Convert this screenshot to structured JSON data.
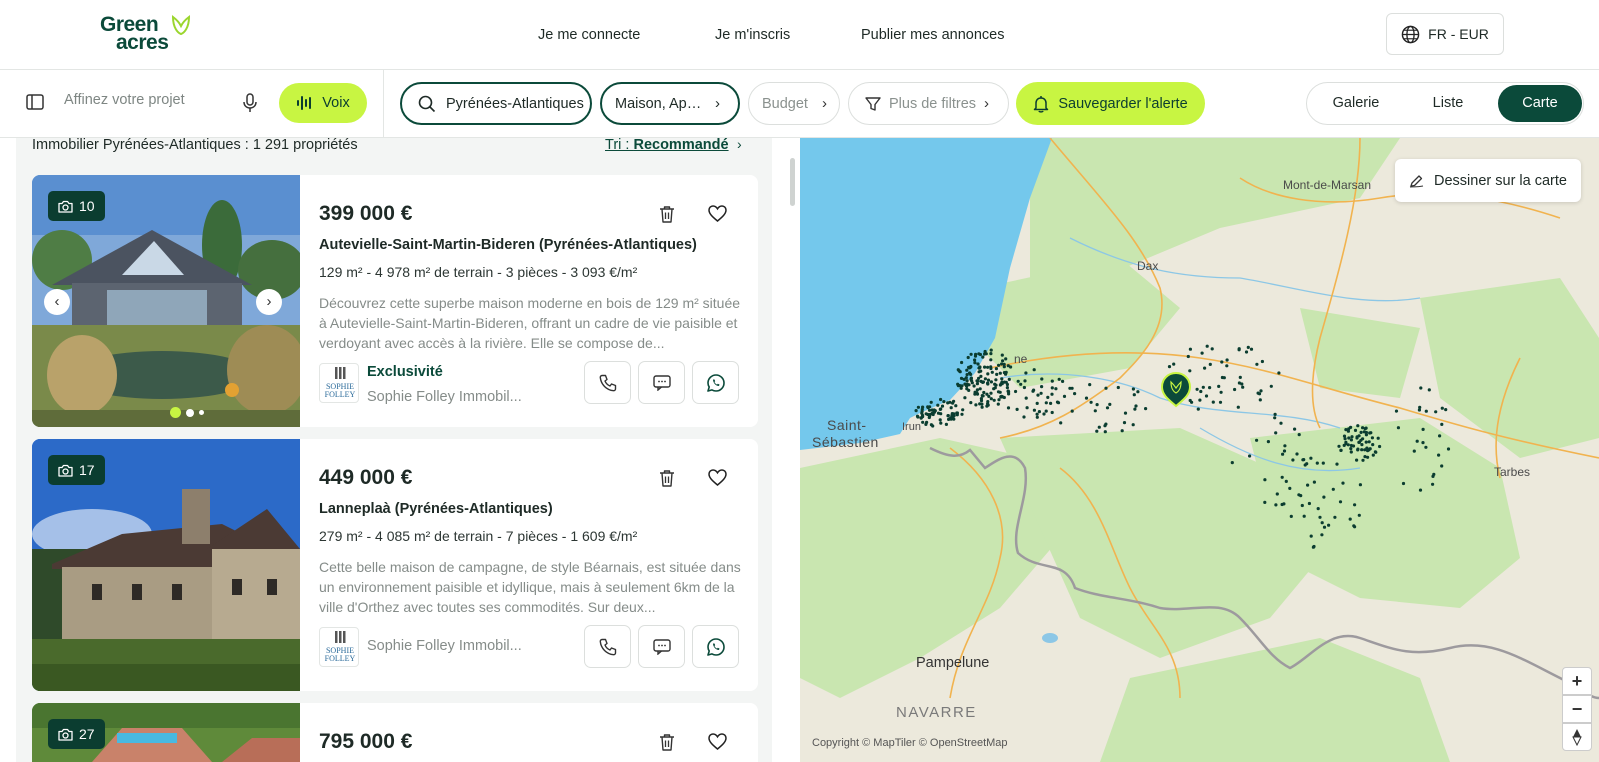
{
  "brand": {
    "line1": "Green",
    "line2": "acres",
    "color": "#0b4a3a"
  },
  "topnav": {
    "login": "Je me connecte",
    "signup": "Je m'inscris",
    "publish": "Publier mes annonces"
  },
  "lang": {
    "label": "FR - EUR"
  },
  "search": {
    "refine_placeholder": "Affinez votre projet",
    "voice_label": "Voix",
    "location": "Pyrénées-Atlantiques",
    "property_types": "Maison, Appartement",
    "budget": "Budget",
    "more_filters": "Plus de filtres",
    "save_alert": "Sauvegarder l'alerte"
  },
  "views": {
    "gallery": "Galerie",
    "list": "Liste",
    "map": "Carte",
    "active": "Carte"
  },
  "results": {
    "count_text": "Immobilier Pyrénées-Atlantiques : 1 291 propriétés",
    "sort_prefix": "Tri : ",
    "sort_value": "Recommandé"
  },
  "listings": [
    {
      "photos": "10",
      "price": "399 000 €",
      "title": "Autevielle-Saint-Martin-Bideren (Pyrénées-Atlantiques)",
      "specs": "129 m² - 4 978 m² de terrain - 3 pièces - 3 093 €/m²",
      "description": "Découvrez cette superbe maison moderne en bois de 129 m² située à Autevielle-Saint-Martin-Bideren, offrant un cadre de vie paisible et verdoyant avec accès à la rivière. Elle se compose de...",
      "badge": "Exclusivité",
      "agency": "Sophie Folley Immobil..."
    },
    {
      "photos": "17",
      "price": "449 000 €",
      "title": "Lanneplaà (Pyrénées-Atlantiques)",
      "specs": "279 m² - 4 085 m² de terrain - 7 pièces - 1 609 €/m²",
      "description": "Cette belle maison de campagne, de style Béarnais, est située dans un environnement paisible et idyllique, mais à seulement 6km de la ville d'Orthez avec toutes ses commodités. Sur deux...",
      "badge": "",
      "agency": "Sophie Folley Immobil..."
    },
    {
      "photos": "27",
      "price": "795 000 €"
    }
  ],
  "agency_logo": {
    "line1": "SOPHIE",
    "line2": "FOLLEY"
  },
  "map": {
    "draw_button": "Dessiner sur la carte",
    "zoom_in": "+",
    "zoom_out": "−",
    "copyright": "Copyright © MapTiler © OpenStreetMap",
    "labels": {
      "mont_de_marsan": "Mont-de-Marsan",
      "dax": "Dax",
      "saint_sebastien_1": "Saint-",
      "saint_sebastien_2": "Sébastien",
      "irun": "Irun",
      "tarbes": "Tarbes",
      "pampelune": "Pampelune",
      "navarre": "NAVARRE",
      "bayonne_partial": "ne"
    }
  },
  "colors": {
    "accent": "#c8f542",
    "dark_green": "#0b4a3a",
    "sea": "#74c8ec",
    "land": "#ece9dc",
    "forest": "#c9e6b0"
  }
}
